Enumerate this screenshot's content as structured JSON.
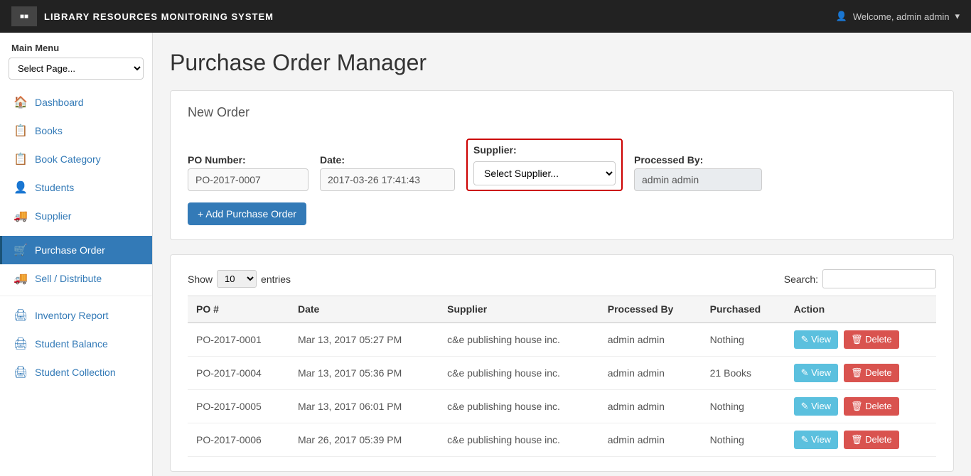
{
  "header": {
    "title": "LIBRARY RESOURCES MONITORING SYSTEM",
    "user_label": "Welcome, admin admin",
    "dropdown_icon": "▾"
  },
  "sidebar": {
    "menu_label": "Main Menu",
    "select_placeholder": "Select Page...",
    "items": [
      {
        "id": "dashboard",
        "label": "Dashboard",
        "icon": "🏠",
        "active": false
      },
      {
        "id": "books",
        "label": "Books",
        "icon": "📋",
        "active": false
      },
      {
        "id": "book-category",
        "label": "Book Category",
        "icon": "📋",
        "active": false
      },
      {
        "id": "students",
        "label": "Students",
        "icon": "👤",
        "active": false
      },
      {
        "id": "supplier",
        "label": "Supplier",
        "icon": "🚚",
        "active": false
      },
      {
        "id": "purchase-order",
        "label": "Purchase Order",
        "icon": "🛒",
        "active": true
      },
      {
        "id": "sell-distribute",
        "label": "Sell / Distribute",
        "icon": "🚚",
        "active": false
      },
      {
        "id": "inventory-report",
        "label": "Inventory Report",
        "icon": "🖨",
        "active": false
      },
      {
        "id": "student-balance",
        "label": "Student Balance",
        "icon": "🖨",
        "active": false
      },
      {
        "id": "student-collection",
        "label": "Student Collection",
        "icon": "🖨",
        "active": false
      }
    ]
  },
  "main": {
    "page_title": "Purchase Order Manager",
    "new_order": {
      "card_title": "New Order",
      "po_number_label": "PO Number:",
      "po_number_value": "PO-2017-0007",
      "date_label": "Date:",
      "date_value": "2017-03-26 17:41:43",
      "supplier_label": "Supplier:",
      "supplier_placeholder": "Select Supplier...",
      "processed_by_label": "Processed By:",
      "processed_by_value": "admin admin",
      "add_button_label": "+ Add Purchase Order"
    },
    "table": {
      "show_label": "Show",
      "show_value": "10",
      "entries_label": "entries",
      "search_label": "Search:",
      "columns": [
        "PO #",
        "Date",
        "Supplier",
        "Processed By",
        "Purchased",
        "Action"
      ],
      "rows": [
        {
          "po": "PO-2017-0001",
          "date": "Mar 13, 2017 05:27 PM",
          "supplier": "c&e publishing house inc.",
          "processed_by": "admin admin",
          "purchased": "Nothing"
        },
        {
          "po": "PO-2017-0004",
          "date": "Mar 13, 2017 05:36 PM",
          "supplier": "c&e publishing house inc.",
          "processed_by": "admin admin",
          "purchased": "21 Books"
        },
        {
          "po": "PO-2017-0005",
          "date": "Mar 13, 2017 06:01 PM",
          "supplier": "c&e publishing house inc.",
          "processed_by": "admin admin",
          "purchased": "Nothing"
        },
        {
          "po": "PO-2017-0006",
          "date": "Mar 26, 2017 05:39 PM",
          "supplier": "c&e publishing house inc.",
          "processed_by": "admin admin",
          "purchased": "Nothing"
        }
      ],
      "view_label": "View",
      "delete_label": "Delete"
    }
  }
}
